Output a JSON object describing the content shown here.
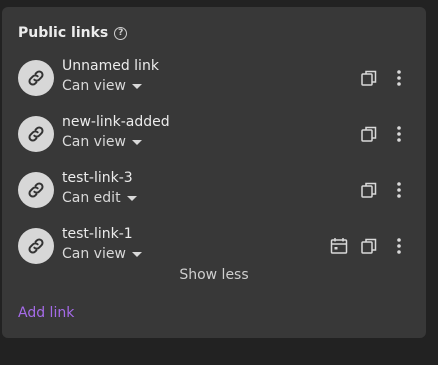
{
  "panel": {
    "title": "Public links",
    "help_icon": "question-circle-icon"
  },
  "links": [
    {
      "name": "Unnamed link",
      "permission": "Can view",
      "has_expiry": false
    },
    {
      "name": "new-link-added",
      "permission": "Can view",
      "has_expiry": false
    },
    {
      "name": "test-link-3",
      "permission": "Can edit",
      "has_expiry": false
    },
    {
      "name": "test-link-1",
      "permission": "Can view",
      "has_expiry": true
    }
  ],
  "actions": {
    "show_less": "Show less",
    "add_link": "Add link"
  },
  "icons": {
    "avatar": "link-icon",
    "copy": "copy-icon",
    "more": "more-vertical-icon",
    "expiry": "calendar-icon",
    "caret": "caret-down-icon"
  },
  "colors": {
    "background": "#222222",
    "panel": "#383838",
    "accent": "#a56be8",
    "text": "#ececec",
    "avatar_bg": "#d7d7d7"
  }
}
